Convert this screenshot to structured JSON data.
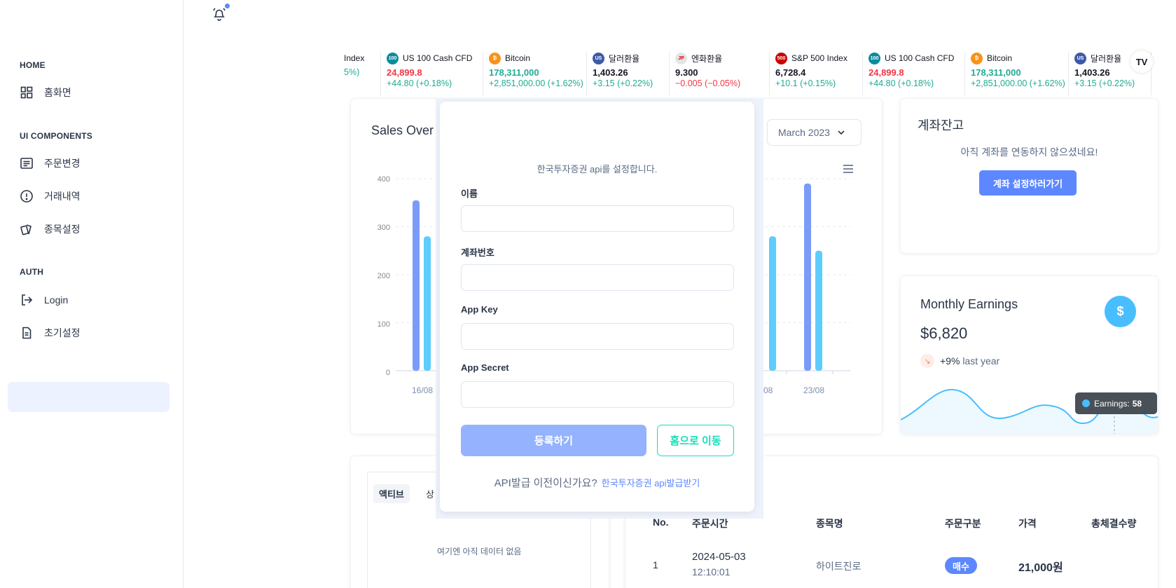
{
  "sidebar": {
    "sections": [
      {
        "title": "HOME",
        "items": [
          {
            "label": "홈화면",
            "icon": "dashboard-icon"
          }
        ]
      },
      {
        "title": "UI COMPONENTS",
        "items": [
          {
            "label": "주문변경",
            "icon": "list-icon"
          },
          {
            "label": "거래내역",
            "icon": "alert-circle-icon"
          },
          {
            "label": "종목설정",
            "icon": "cards-icon"
          }
        ]
      },
      {
        "title": "AUTH",
        "items": [
          {
            "label": "Login",
            "icon": "login-icon"
          },
          {
            "label": "초기설정",
            "icon": "file-icon"
          }
        ]
      }
    ]
  },
  "ticker": [
    {
      "name": "Index",
      "price": "",
      "change": "5%)",
      "logo": "",
      "logo_color": "",
      "price_class": "neutral",
      "change_class": "up"
    },
    {
      "name": "US 100 Cash CFD",
      "price": "24,899.8",
      "change": "+44.80 (+0.18%)",
      "logo": "100",
      "logo_color": "#0b8a9e",
      "price_class": "down",
      "change_class": "up"
    },
    {
      "name": "Bitcoin",
      "price": "178,311,000",
      "change": "+2,851,000.00 (+1.62%)",
      "logo": "₿",
      "logo_color": "#f7931a",
      "price_class": "up",
      "change_class": "up"
    },
    {
      "name": "달러환율",
      "price": "1,403.26",
      "change": "+3.15 (+0.22%)",
      "logo": "US",
      "logo_color": "#3c5aa6",
      "price_class": "neutral",
      "change_class": "up"
    },
    {
      "name": "엔화환율",
      "price": "9.300",
      "change": "−0.005 (−0.05%)",
      "logo": "JP",
      "logo_color": "#e5e5e5",
      "price_class": "neutral",
      "change_class": "down"
    },
    {
      "name": "S&P 500 Index",
      "price": "6,728.4",
      "change": "+10.1 (+0.15%)",
      "logo": "500",
      "logo_color": "#cc0000",
      "price_class": "neutral",
      "change_class": "up"
    },
    {
      "name": "US 100 Cash CFD",
      "price": "24,899.8",
      "change": "+44.80 (+0.18%)",
      "logo": "100",
      "logo_color": "#0b8a9e",
      "price_class": "down",
      "change_class": "up"
    },
    {
      "name": "Bitcoin",
      "price": "178,311,000",
      "change": "+2,851,000.00 (+1.62%)",
      "logo": "₿",
      "logo_color": "#f7931a",
      "price_class": "up",
      "change_class": "up"
    },
    {
      "name": "달러환율",
      "price": "1,403.26",
      "change": "+3.15 (+0.22%)",
      "logo": "US",
      "logo_color": "#3c5aa6",
      "price_class": "neutral",
      "change_class": "up"
    }
  ],
  "sales": {
    "title": "Sales Over",
    "month": "March 2023",
    "y_ticks": [
      "400",
      "300",
      "200",
      "100",
      "0"
    ],
    "x_ticks": [
      "16/08",
      "08",
      "23/08"
    ]
  },
  "chart_data": {
    "type": "bar",
    "categories": [
      "16/08",
      "22/08",
      "23/08"
    ],
    "series": [
      {
        "values": [
          355,
          0,
          390
        ]
      },
      {
        "values": [
          280,
          280,
          250
        ]
      }
    ],
    "ylim": [
      0,
      400
    ],
    "yticks": [
      0,
      100,
      200,
      300,
      400
    ],
    "colors": [
      "#7a9cf8",
      "#5ccdfc"
    ],
    "grid": true
  },
  "modal": {
    "subtitle": "한국투자증권 api를 설정합니다.",
    "fields": [
      "이름",
      "계좌번호",
      "App Key",
      "App Secret"
    ],
    "register_label": "등록하기",
    "home_label": "홈으로 이동",
    "footer_text": "API발급 이전이신가요?",
    "footer_link": "한국투자증권 api발급받기"
  },
  "account": {
    "title": "계좌잔고",
    "message": "아직 계좌를 연동하지 않으셨네요!",
    "button": "계좌 설정하러가기"
  },
  "earnings": {
    "title": "Monthly Earnings",
    "amount": "$6,820",
    "pct": "+9%",
    "pct_label": "last year",
    "icon": "dollar-icon",
    "tooltip_label": "Earnings:",
    "tooltip_value": "58",
    "accent": "#49beff"
  },
  "orders": {
    "tabs": [
      "액티브",
      "상"
    ],
    "empty": "여기엔 아직 데이터 없음"
  },
  "trade_table": {
    "headers": [
      "No.",
      "주문시간",
      "종목명",
      "주문구분",
      "가격",
      "총체결수량"
    ],
    "rows": [
      {
        "no": "1",
        "date": "2024-05-03",
        "time": "12:10:01",
        "name": "하이트진로",
        "type": "매수",
        "price": "21,000원"
      }
    ]
  }
}
